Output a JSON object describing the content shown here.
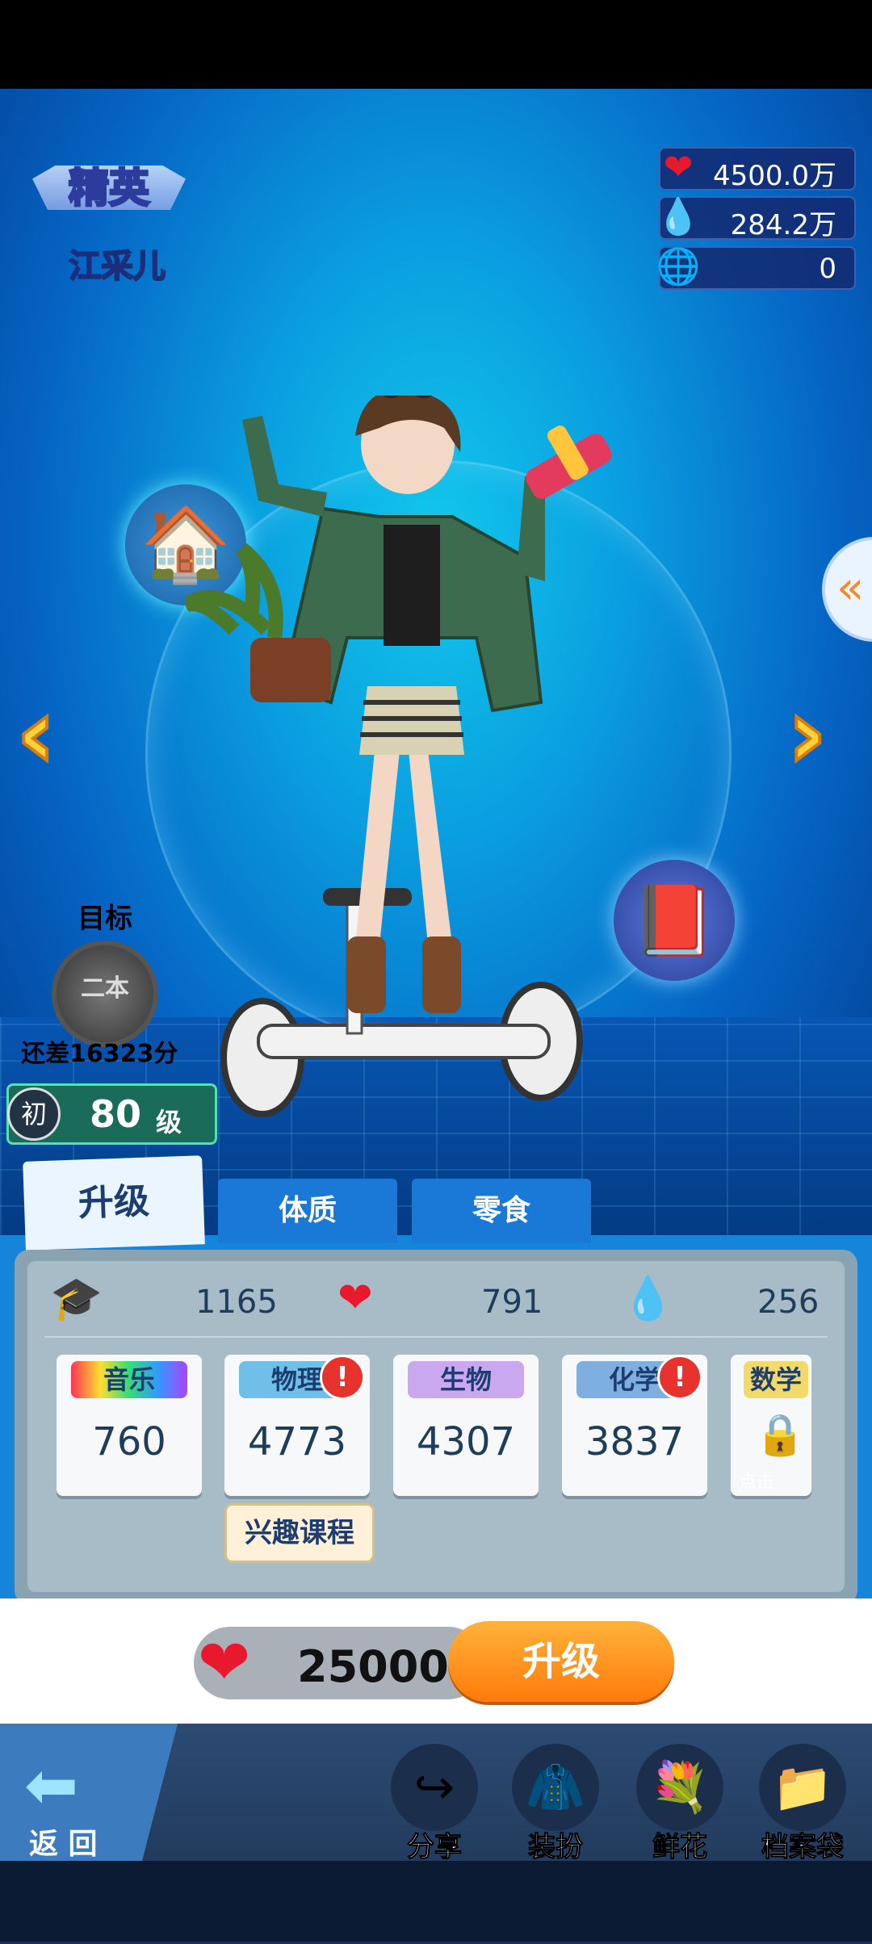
{
  "header": {
    "rank": "精英",
    "name": "江采儿"
  },
  "resources": [
    {
      "icon": "heart-icon",
      "value": "4500.0万"
    },
    {
      "icon": "water-drop-icon",
      "value": "284.2万"
    },
    {
      "icon": "globe-icon",
      "value": "0"
    }
  ],
  "goal": {
    "label": "目标",
    "badge": "二本",
    "remaining": "还差16323分"
  },
  "level": {
    "prefix": "初",
    "number": "80",
    "unit": "级"
  },
  "tabs": [
    "升级",
    "体质",
    "零食"
  ],
  "stats": {
    "cap": "1165",
    "heart": "791",
    "drop": "256"
  },
  "subjects": [
    {
      "name": "音乐",
      "value": "760",
      "alert": false
    },
    {
      "name": "物理",
      "value": "4773",
      "alert": true
    },
    {
      "name": "生物",
      "value": "4307",
      "alert": false
    },
    {
      "name": "化学",
      "value": "3837",
      "alert": true
    },
    {
      "name": "数学",
      "value": "",
      "locked": true,
      "lock_text": "点击"
    }
  ],
  "alert_mark": "!",
  "course_tag": "兴趣课程",
  "upgrade": {
    "cost": "25000",
    "button": "升级"
  },
  "nav": {
    "back": "返 回",
    "items": [
      "分享",
      "装扮",
      "鲜花",
      "档案袋"
    ]
  },
  "side_tab": "«",
  "arrows": {
    "left": "‹",
    "right": "›"
  }
}
